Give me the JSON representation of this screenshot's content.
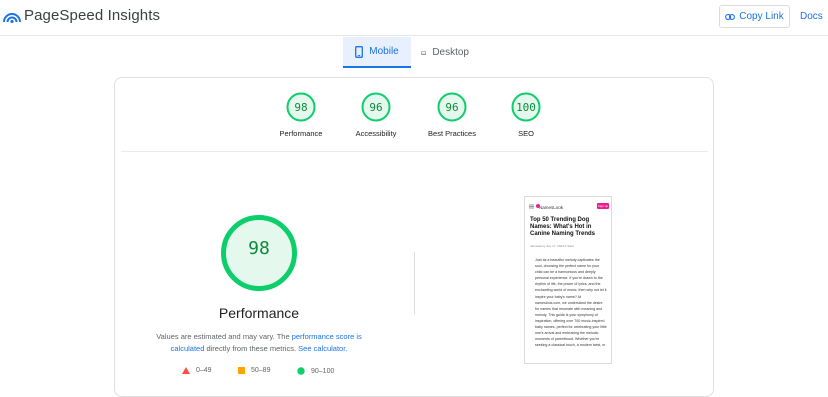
{
  "app": {
    "title": "PageSpeed Insights",
    "copy_link_label": "Copy Link",
    "docs_label": "Docs",
    "accent_color": "#1a73e8"
  },
  "tabs": [
    {
      "label": "Mobile",
      "icon": "mobile-phone-icon",
      "active": true
    },
    {
      "label": "Desktop",
      "icon": "desktop-icon",
      "active": false
    }
  ],
  "scores": [
    {
      "value": "98",
      "label": "Performance"
    },
    {
      "value": "96",
      "label": "Accessibility"
    },
    {
      "value": "96",
      "label": "Best Practices"
    },
    {
      "value": "100",
      "label": "SEO"
    }
  ],
  "performance": {
    "score": "98",
    "title": "Performance",
    "note_prefix": "Values are estimated and may vary. The ",
    "note_link1": "performance score is calculated",
    "note_middle": " directly from these metrics. ",
    "note_link2": "See calculator."
  },
  "legend": [
    {
      "range": "0–49",
      "shape": "triangle",
      "color": "#ff4e42"
    },
    {
      "range": "50–89",
      "shape": "square",
      "color": "#ffa400"
    },
    {
      "range": "90–100",
      "shape": "circle",
      "color": "#0cce6b"
    }
  ],
  "screenshot": {
    "site": "NamesLook",
    "signup": "Sign up",
    "headline": "Top 50 Trending Dog Names: What's Hot in Canine Naming Trends",
    "meta": "namesavvy   July 17, 2024   0   Save",
    "body": "Just as a beautiful melody captivates the soul, choosing the perfect name for your child can be a harmonious and deeply personal experience. If you're drawn to the rhythm of life, the power of lyrics, and the enchanting world of music, then why not let it inspire your baby's name? At nameslook.com, we understand the desire for names that resonate with meaning and melody. This guide is your symphony of inspiration, offering over 700 music-inspired baby names, perfect for celebrating your little one's arrival and embracing the melodic moments of parenthood. Whether you're seeking a classical touch, a modern twist, or"
  },
  "colors": {
    "pass": "#0cce6b",
    "pass_text": "#0c8a3a",
    "pass_fill": "#e5f8ee"
  }
}
